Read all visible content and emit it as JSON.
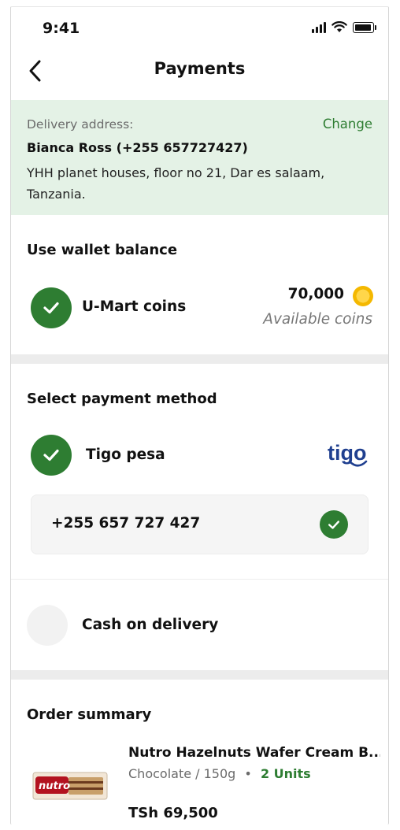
{
  "status_bar": {
    "time": "9:41"
  },
  "header": {
    "title": "Payments"
  },
  "address": {
    "label": "Delivery address:",
    "change_label": "Change",
    "name_phone": "Bianca Ross (+255 657727427)",
    "line": "YHH planet houses, floor no 21, Dar es salaam, Tanzania."
  },
  "wallet": {
    "title": "Use wallet balance",
    "option_label": "U-Mart coins",
    "amount": "70,000",
    "caption": "Available coins"
  },
  "payment": {
    "title": "Select payment method",
    "tigo_label": "Tigo pesa",
    "tigo_logo_text": "tigo",
    "phone_number": "+255 657 727 427",
    "cod_label": "Cash on delivery"
  },
  "order": {
    "title": "Order summary",
    "product_name": "Nutro Hazelnuts Wafer Cream B...",
    "product_category": "Chocolate / 150g",
    "separator": "•",
    "units": "2 Units",
    "price": "TSh 69,500",
    "thumb_brand": "nutro"
  },
  "colors": {
    "accent_green": "#2e7d32",
    "address_bg": "#e4f2e6",
    "tigo_blue": "#1f3f8f",
    "coin_gold": "#f4b800"
  }
}
